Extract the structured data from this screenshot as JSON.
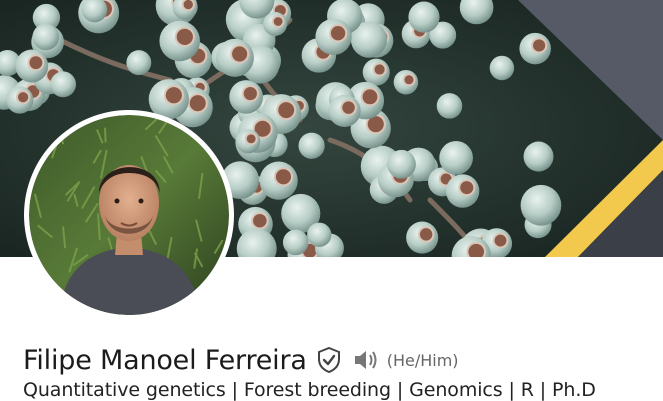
{
  "profile": {
    "name": "Filipe Manoel Ferreira",
    "pronouns": "(He/Him)",
    "headline": "Quantitative genetics | Forest breeding | Genomics | R | Ph.D",
    "badge_icon": "verified-shield-icon",
    "audio_icon": "speaker-icon"
  },
  "colors": {
    "accent_stripe": "#f2c94c",
    "banner_dark": "#1e2a26",
    "name_text": "#1b1b1b",
    "muted_text": "#666666"
  }
}
